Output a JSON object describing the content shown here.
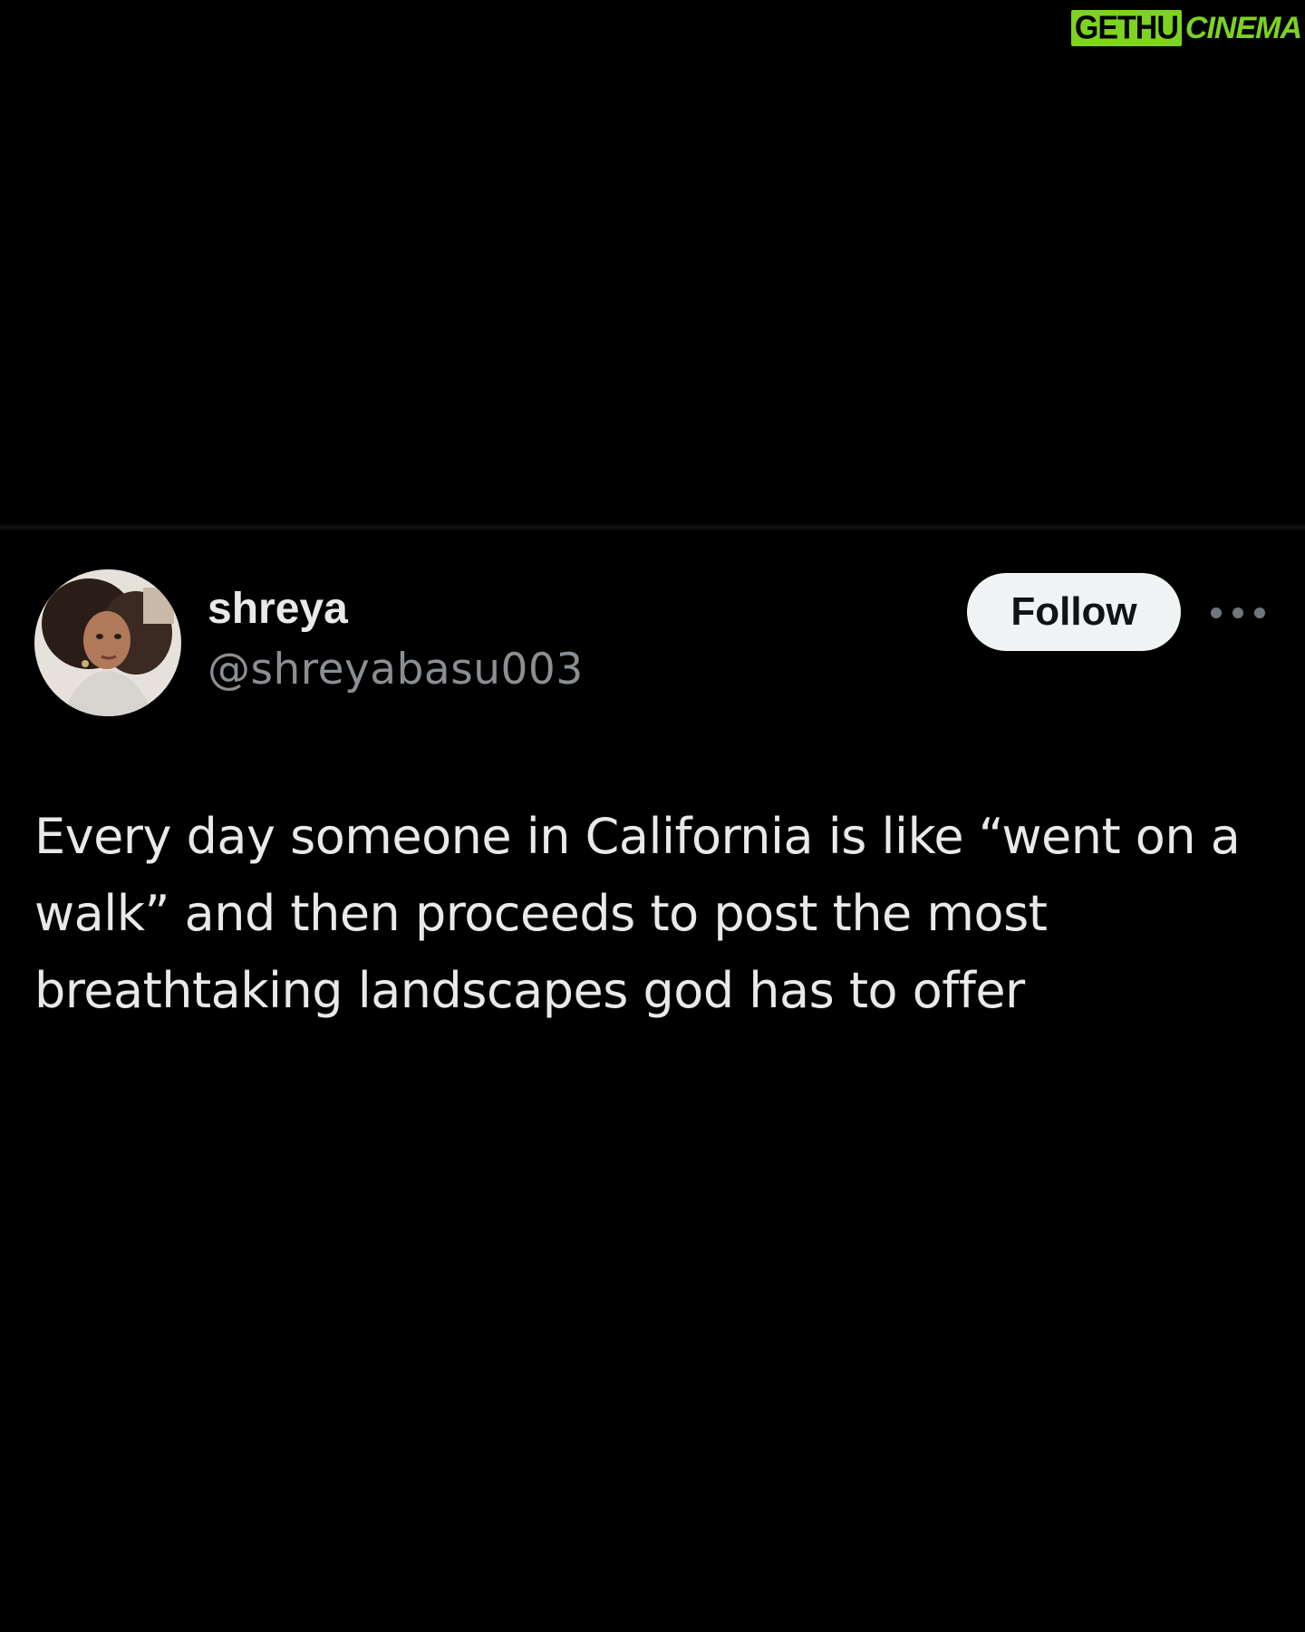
{
  "watermark": {
    "box_text": "GETHU",
    "rest_text": "CINEMA",
    "color": "#7ed321"
  },
  "tweet": {
    "author": {
      "name": "shreya",
      "handle": "@shreyabasu003",
      "avatar_icon": "profile-photo"
    },
    "follow_label": "Follow",
    "more_icon": "ellipsis-icon",
    "text": "Every day someone in California is like “went on a walk” and then proceeds to post the most breathtaking landscapes god has to offer"
  },
  "colors": {
    "background": "#000000",
    "text_primary": "#e7e9ea",
    "text_secondary": "#8b8f93",
    "follow_button_bg": "#eff3f4",
    "follow_button_text": "#0f1419"
  }
}
